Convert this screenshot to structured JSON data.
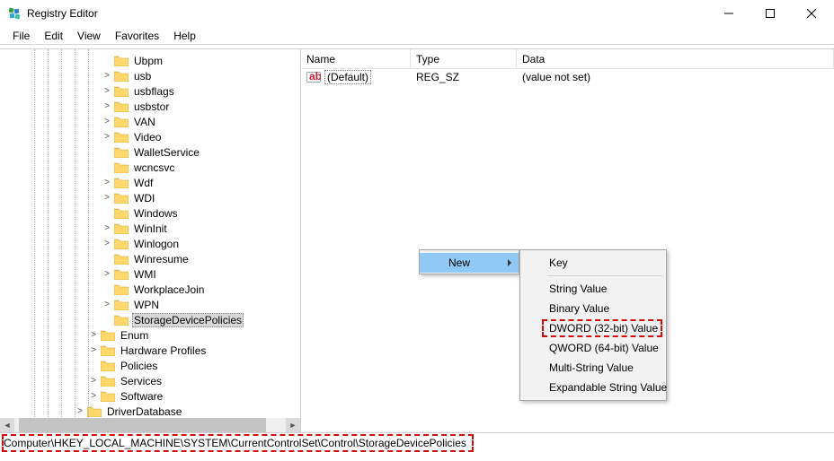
{
  "window": {
    "title": "Registry Editor"
  },
  "menu": {
    "file": "File",
    "edit": "Edit",
    "view": "View",
    "favorites": "Favorites",
    "help": "Help"
  },
  "tree": {
    "items": [
      {
        "indent": 7,
        "exp": "none",
        "label": "Ubpm"
      },
      {
        "indent": 7,
        "exp": "closed",
        "label": "usb"
      },
      {
        "indent": 7,
        "exp": "closed",
        "label": "usbflags"
      },
      {
        "indent": 7,
        "exp": "closed",
        "label": "usbstor"
      },
      {
        "indent": 7,
        "exp": "closed",
        "label": "VAN"
      },
      {
        "indent": 7,
        "exp": "closed",
        "label": "Video"
      },
      {
        "indent": 7,
        "exp": "none",
        "label": "WalletService"
      },
      {
        "indent": 7,
        "exp": "none",
        "label": "wcncsvc"
      },
      {
        "indent": 7,
        "exp": "closed",
        "label": "Wdf"
      },
      {
        "indent": 7,
        "exp": "closed",
        "label": "WDI"
      },
      {
        "indent": 7,
        "exp": "none",
        "label": "Windows"
      },
      {
        "indent": 7,
        "exp": "closed",
        "label": "WinInit"
      },
      {
        "indent": 7,
        "exp": "closed",
        "label": "Winlogon"
      },
      {
        "indent": 7,
        "exp": "none",
        "label": "Winresume"
      },
      {
        "indent": 7,
        "exp": "closed",
        "label": "WMI"
      },
      {
        "indent": 7,
        "exp": "none",
        "label": "WorkplaceJoin"
      },
      {
        "indent": 7,
        "exp": "closed",
        "label": "WPN"
      },
      {
        "indent": 7,
        "exp": "none",
        "label": "StorageDevicePolicies",
        "selected": true
      },
      {
        "indent": 6,
        "exp": "closed",
        "label": "Enum"
      },
      {
        "indent": 6,
        "exp": "closed",
        "label": "Hardware Profiles"
      },
      {
        "indent": 6,
        "exp": "none",
        "label": "Policies"
      },
      {
        "indent": 6,
        "exp": "closed",
        "label": "Services"
      },
      {
        "indent": 6,
        "exp": "closed",
        "label": "Software"
      },
      {
        "indent": 5,
        "exp": "closed",
        "label": "DriverDatabase"
      }
    ]
  },
  "list": {
    "headers": {
      "name": "Name",
      "type": "Type",
      "data": "Data"
    },
    "rows": [
      {
        "name": "(Default)",
        "type": "REG_SZ",
        "data": "(value not set)"
      }
    ]
  },
  "context": {
    "new": "New",
    "sub": {
      "key": "Key",
      "string": "String Value",
      "binary": "Binary Value",
      "dword": "DWORD (32-bit) Value",
      "qword": "QWORD (64-bit) Value",
      "multi": "Multi-String Value",
      "expand": "Expandable String Value"
    }
  },
  "status": {
    "path": "Computer\\HKEY_LOCAL_MACHINE\\SYSTEM\\CurrentControlSet\\Control\\StorageDevicePolicies"
  }
}
